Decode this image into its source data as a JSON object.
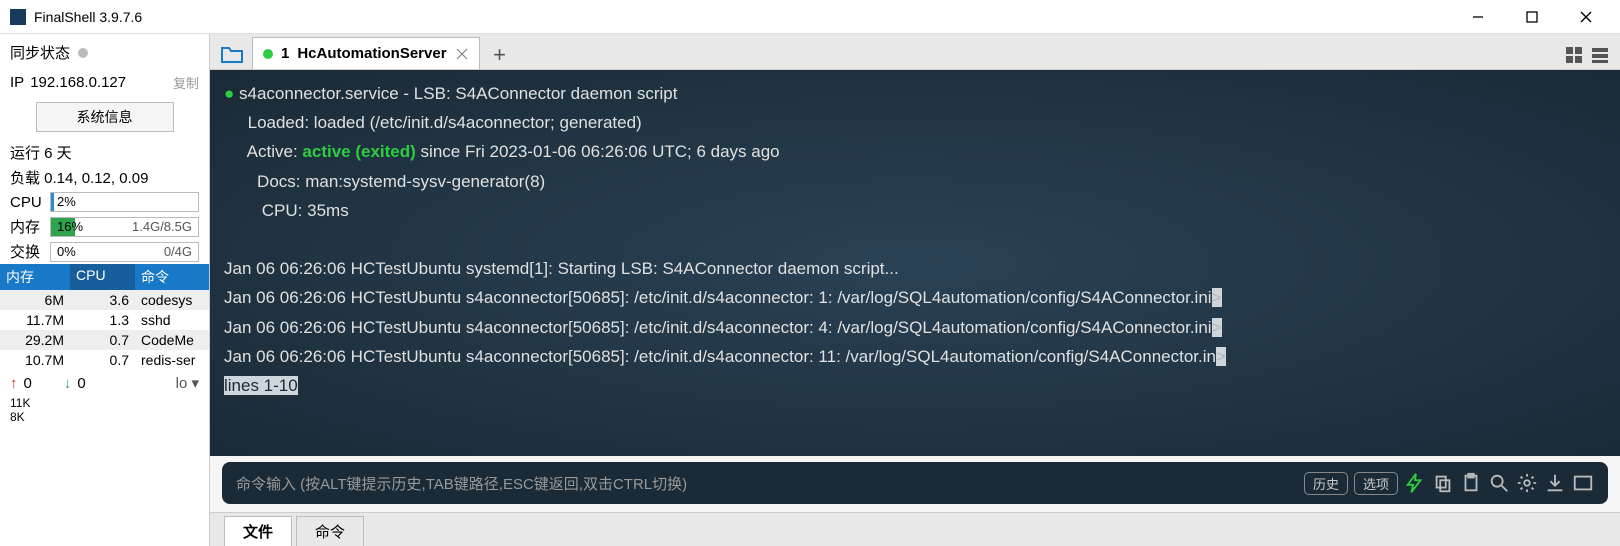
{
  "app": {
    "title": "FinalShell 3.9.7.6"
  },
  "window_controls": {
    "min": "minimize",
    "max": "maximize",
    "close": "close"
  },
  "sidebar": {
    "sync_label": "同步状态",
    "ip_label": "IP",
    "ip": "192.168.0.127",
    "copy": "复制",
    "sysinfo_btn": "系统信息",
    "uptime": "运行 6 天",
    "load": "负载 0.14, 0.12, 0.09",
    "cpu_label": "CPU",
    "cpu_pct": "2%",
    "mem_label": "内存",
    "mem_pct": "16%",
    "mem_text": "1.4G/8.5G",
    "swap_label": "交换",
    "swap_pct": "0%",
    "swap_text": "0/4G",
    "proc_headers": {
      "mem": "内存",
      "cpu": "CPU",
      "cmd": "命令"
    },
    "procs": [
      {
        "mem": "6M",
        "cpu": "3.6",
        "cmd": "codesys"
      },
      {
        "mem": "11.7M",
        "cpu": "1.3",
        "cmd": "sshd"
      },
      {
        "mem": "29.2M",
        "cpu": "0.7",
        "cmd": "CodeMe"
      },
      {
        "mem": "10.7M",
        "cpu": "0.7",
        "cmd": "redis-ser"
      }
    ],
    "net_up": "0",
    "net_down": "0",
    "net_if": "lo",
    "scale1": "11K",
    "scale2": "8K"
  },
  "tab": {
    "index": "1",
    "label": "HcAutomationServer"
  },
  "terminal": {
    "l1a": "● ",
    "l1b": "s4aconnector.service - LSB: S4AConnector daemon script",
    "l2": "     Loaded: loaded (/etc/init.d/s4aconnector; generated)",
    "l3a": "     Active: ",
    "l3b": "active (exited)",
    "l3c": " since Fri 2023-01-06 06:26:06 UTC; 6 days ago",
    "l4": "       Docs: man:systemd-sysv-generator(8)",
    "l5": "        CPU: 35ms",
    "l6": "",
    "l7": "Jan 06 06:26:06 HCTestUbuntu systemd[1]: Starting LSB: S4AConnector daemon script...",
    "l8": "Jan 06 06:26:06 HCTestUbuntu s4aconnector[50685]: /etc/init.d/s4aconnector: 1: /var/log/SQL4automation/config/S4AConnector.ini",
    "l9": "Jan 06 06:26:06 HCTestUbuntu s4aconnector[50685]: /etc/init.d/s4aconnector: 4: /var/log/SQL4automation/config/S4AConnector.ini",
    "l10": "Jan 06 06:26:06 HCTestUbuntu s4aconnector[50685]: /etc/init.d/s4aconnector: 11: /var/log/SQL4automation/config/S4AConnector.in",
    "arrow": ">",
    "lines": "lines 1-10"
  },
  "cmdbar": {
    "placeholder": "命令输入 (按ALT键提示历史,TAB键路径,ESC键返回,双击CTRL切换)",
    "history": "历史",
    "options": "选项"
  },
  "bottom": {
    "tab1": "文件",
    "tab2": "命令"
  }
}
